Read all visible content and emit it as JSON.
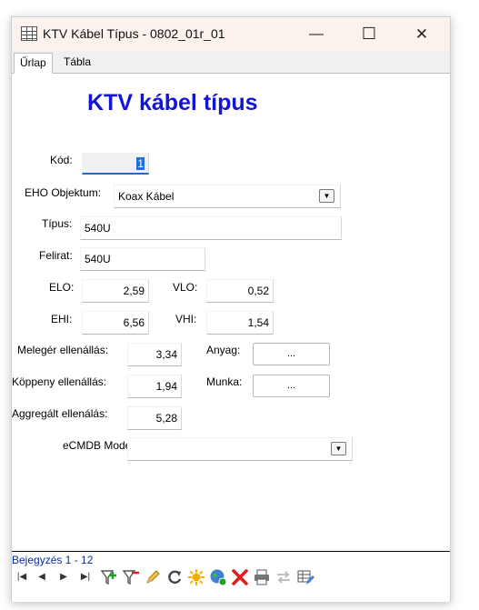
{
  "window": {
    "title": "KTV Kábel Típus - 0802_01r_01",
    "minimize_glyph": "—",
    "maximize_glyph": "☐",
    "close_glyph": "✕"
  },
  "tabs": [
    {
      "label": "Űrlap",
      "active": true
    },
    {
      "label": "Tábla",
      "active": false
    }
  ],
  "form": {
    "heading": "KTV kábel típus",
    "kod": {
      "label": "Kód:",
      "value": "1"
    },
    "eho": {
      "label": "EHO Objektum:",
      "value": "Koax Kábel"
    },
    "tipus": {
      "label": "Típus:",
      "value": "540U"
    },
    "felirat": {
      "label": "Felirat:",
      "value": "540U"
    },
    "elo": {
      "label": "ELO:",
      "value": "2,59"
    },
    "vlo": {
      "label": "VLO:",
      "value": "0,52"
    },
    "ehi": {
      "label": "EHI:",
      "value": "6,56"
    },
    "vhi": {
      "label": "VHI:",
      "value": "1,54"
    },
    "meleger": {
      "label": "Melegér ellenállás:",
      "value": "3,34"
    },
    "koppeny": {
      "label": "Köppeny ellenállás:",
      "value": "1,94"
    },
    "aggregalt": {
      "label": "Aggregált ellenálás:",
      "value": "5,28"
    },
    "anyag": {
      "label": "Anyag:",
      "button": "..."
    },
    "munka": {
      "label": "Munka:",
      "button": "..."
    },
    "ecmdb": {
      "label": "eCMDB Modell:",
      "value": ""
    },
    "dropdown_glyph": "▼"
  },
  "navigator": {
    "status": "Bejegyzés 1 - 12",
    "first": "|◀",
    "prev": "◀",
    "next": "▶",
    "last": "▶|"
  },
  "toolbar": {
    "icons": [
      "filter-add-icon",
      "filter-remove-icon",
      "edit-pencil-icon",
      "refresh-icon",
      "new-record-icon",
      "globe-icon",
      "delete-icon",
      "print-icon",
      "transfer-icon",
      "table-edit-icon"
    ],
    "colors": {
      "accent": "#1414d4",
      "status": "#0a2aa8",
      "delete": "#e02020",
      "add": "#20a020"
    }
  }
}
